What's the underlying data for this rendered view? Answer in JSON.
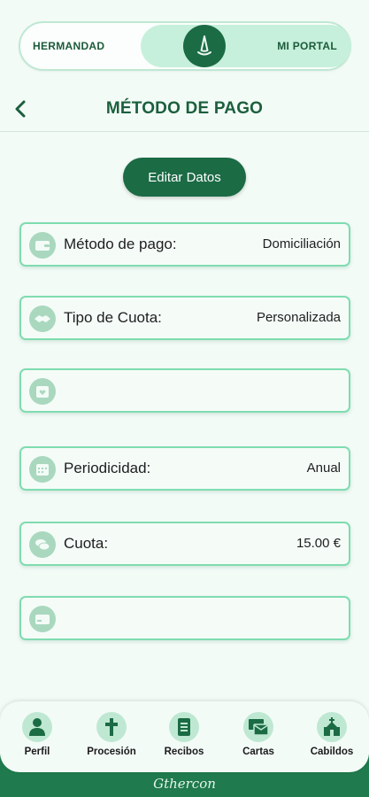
{
  "toggle": {
    "left_label": "HERMANDAD",
    "right_label": "MI PORTAL",
    "selected": "MI PORTAL"
  },
  "header": {
    "title": "MÉTODO DE PAGO",
    "back_icon": "chevron-left-icon"
  },
  "edit_button": "Editar Datos",
  "cards": [
    {
      "icon": "wallet-icon",
      "label": "Método de pago:",
      "value": "Domiciliación"
    },
    {
      "icon": "handshake-icon",
      "label": "Tipo de Cuota:",
      "value": "Personalizada"
    },
    {
      "icon": "calendar-heart-icon",
      "label": "",
      "value": ""
    },
    {
      "icon": "calendar-icon",
      "label": "Periodicidad:",
      "value": "Anual"
    },
    {
      "icon": "coins-icon",
      "label": "Cuota:",
      "value": "15.00 €"
    },
    {
      "icon": "card-icon",
      "label": "",
      "value": ""
    }
  ],
  "nav": [
    {
      "icon": "person-icon",
      "label": "Perfil"
    },
    {
      "icon": "cross-icon",
      "label": "Procesión"
    },
    {
      "icon": "receipt-icon",
      "label": "Recibos"
    },
    {
      "icon": "letters-icon",
      "label": "Cartas"
    },
    {
      "icon": "church-icon",
      "label": "Cabildos"
    }
  ],
  "footer": {
    "brand": "Gthercon"
  },
  "colors": {
    "primary": "#1b6b45",
    "accent": "#7fdcb0",
    "background": "#f3fbf7"
  }
}
